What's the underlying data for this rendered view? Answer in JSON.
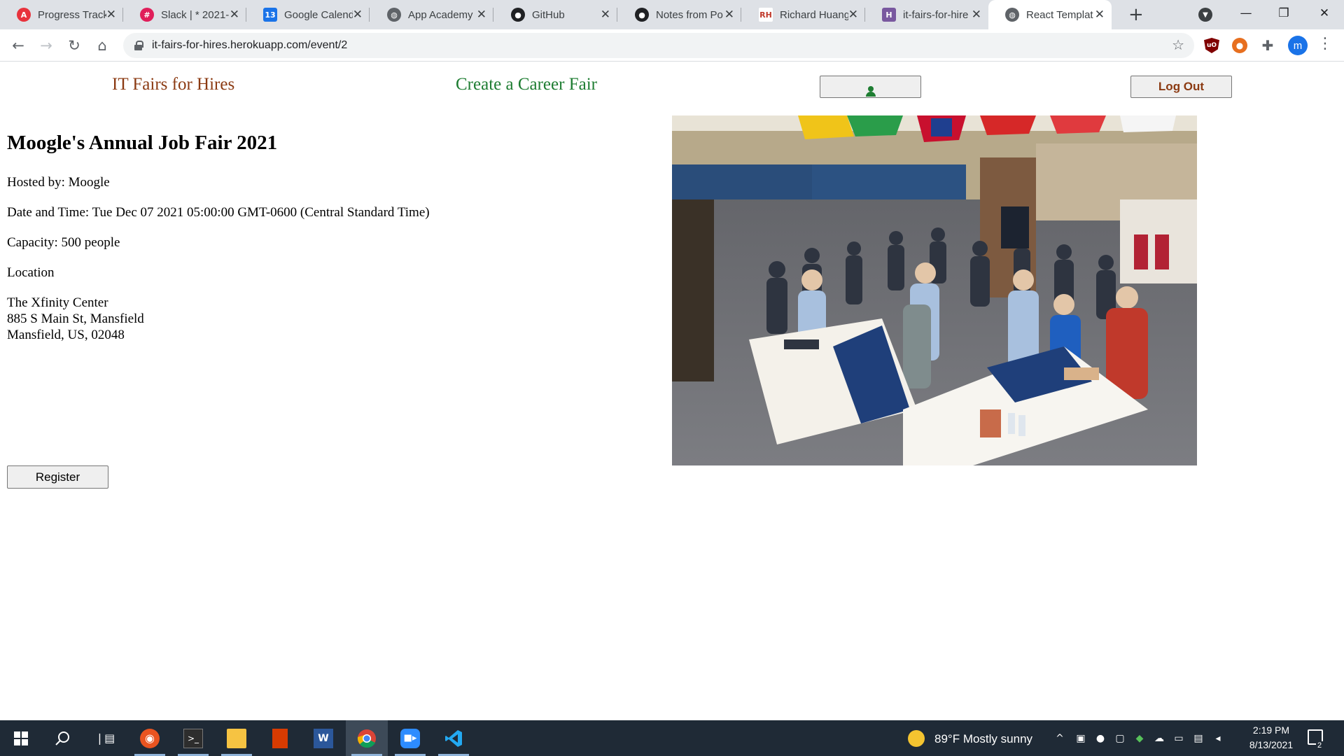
{
  "browser": {
    "tabs": [
      {
        "title": "Progress Track",
        "icon": "app-academy-progress-icon",
        "color": "#e8323c",
        "glyph": "A"
      },
      {
        "title": "Slack | * 2021-",
        "icon": "slack-icon",
        "color": "#e01e5a",
        "glyph": "#"
      },
      {
        "title": "Google Calend",
        "icon": "google-calendar-icon",
        "color": "#1a73e8",
        "glyph": "13"
      },
      {
        "title": "App Academy",
        "icon": "globe-icon",
        "color": "#5f6368",
        "glyph": "◍"
      },
      {
        "title": "GitHub",
        "icon": "github-icon",
        "color": "#202124",
        "glyph": "●"
      },
      {
        "title": "Notes from Po",
        "icon": "github-icon",
        "color": "#202124",
        "glyph": "●"
      },
      {
        "title": "Richard Huang",
        "icon": "rh-initials-icon",
        "color": "#ffffff",
        "glyph": "RH"
      },
      {
        "title": "it-fairs-for-hire",
        "icon": "heroku-icon",
        "color": "#79589f",
        "glyph": "H"
      },
      {
        "title": "React Templat",
        "icon": "globe-icon",
        "color": "#5f6368",
        "glyph": "◍"
      }
    ],
    "url": "it-fairs-for-hires.herokuapp.com/event/2",
    "profile_initial": "m",
    "extensions": {
      "ublock": "uO"
    }
  },
  "nav": {
    "home": "IT Fairs for Hires",
    "create": "Create a Career Fair",
    "logout": "Log Out"
  },
  "event": {
    "title": "Moogle's Annual Job Fair 2021",
    "hosted_by": "Hosted by: Moogle",
    "date_time": "Date and Time: Tue Dec 07 2021 05:00:00 GMT-0600 (Central Standard Time)",
    "capacity": "Capacity: 500 people",
    "location_label": "Location",
    "venue": "The Xfinity Center",
    "street": "885 S Main St, Mansfield",
    "city": "Mansfield, US, 02048",
    "register": "Register"
  },
  "taskbar": {
    "weather": "89°F  Mostly sunny",
    "time": "2:19 PM",
    "date": "8/13/2021",
    "notifications": "2"
  },
  "colors": {
    "home_link": "#8b3a12",
    "create_link": "#1e7d32",
    "taskbar": "#1f2a36"
  }
}
